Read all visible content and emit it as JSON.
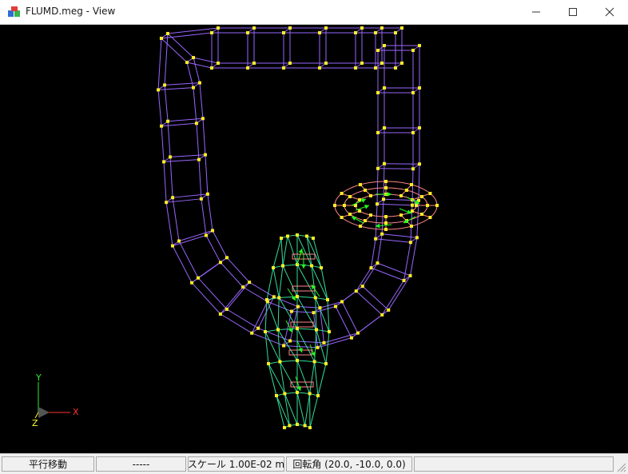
{
  "window": {
    "title": "FLUMD.meg - View"
  },
  "colors": {
    "background": "#000000",
    "pipe": "#9966ff",
    "fan": "#33dd99",
    "ring": "#ff8888",
    "node": "#ffee22",
    "arrow": "#22ff22",
    "axis_x": "#ff3333",
    "axis_y": "#33ee33",
    "axis_z": "#ffff33"
  },
  "axes": {
    "x": "X",
    "y": "Y",
    "z": "Z"
  },
  "status": {
    "mode": "平行移動",
    "value": "-----",
    "scale": "スケール 1.00E-02 m",
    "rotation": "回転角 (20.0, -10.0, 0.0)"
  },
  "icons": [
    "app-icon",
    "minimize-icon",
    "maximize-icon",
    "close-icon",
    "resize-grip-icon"
  ]
}
